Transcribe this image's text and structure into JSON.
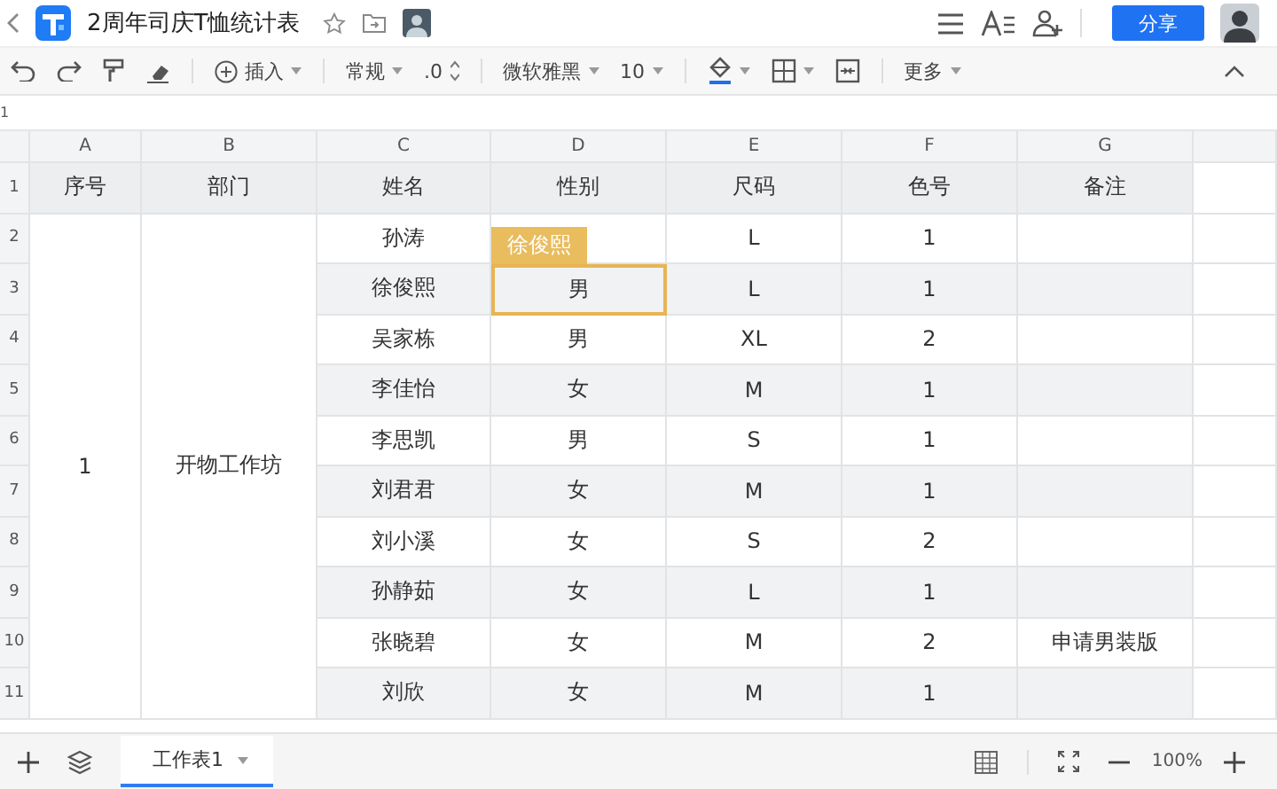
{
  "title": "2周年司庆T恤统计表",
  "share_button": "分享",
  "toolbar": {
    "insert": "插入",
    "number_format": "常规",
    "decimal": ".0",
    "font": "微软雅黑",
    "font_size": "10",
    "more": "更多"
  },
  "formula_bar": {
    "cell_ref": "1"
  },
  "columns": [
    "A",
    "B",
    "C",
    "D",
    "E",
    "F",
    "G"
  ],
  "header_row": {
    "number": "1",
    "cells": [
      "序号",
      "部门",
      "姓名",
      "性别",
      "尺码",
      "色号",
      "备注"
    ]
  },
  "group": {
    "index": "1",
    "department": "开物工作坊"
  },
  "rows": [
    {
      "number": "2",
      "cells": [
        {
          "text": "孙涛",
          "selected": false
        },
        {
          "selected": false
        },
        {
          "text": "L",
          "selected": false
        },
        {
          "text": "1",
          "selected": false
        },
        {
          "selected": false
        }
      ]
    },
    {
      "number": "3",
      "cells": [
        {
          "text": "徐俊熙",
          "selected": false
        },
        {
          "text": "男",
          "selected": true,
          "collaborator": "徐俊熙"
        },
        {
          "text": "L",
          "selected": false
        },
        {
          "text": "1",
          "selected": false
        },
        {
          "selected": false
        }
      ]
    },
    {
      "number": "4",
      "cells": [
        {
          "text": "吴家栋",
          "selected": false
        },
        {
          "text": "男",
          "selected": false
        },
        {
          "text": "XL",
          "selected": false
        },
        {
          "text": "2",
          "selected": false
        },
        {
          "selected": false
        }
      ]
    },
    {
      "number": "5",
      "cells": [
        {
          "text": "李佳怡",
          "selected": false
        },
        {
          "text": "女",
          "selected": false
        },
        {
          "text": "M",
          "selected": false
        },
        {
          "text": "1",
          "selected": false
        },
        {
          "selected": false
        }
      ]
    },
    {
      "number": "6",
      "cells": [
        {
          "text": "李思凯",
          "selected": false
        },
        {
          "text": "男",
          "selected": false
        },
        {
          "text": "S",
          "selected": false
        },
        {
          "text": "1",
          "selected": false
        },
        {
          "selected": false
        }
      ]
    },
    {
      "number": "7",
      "cells": [
        {
          "text": "刘君君",
          "selected": false
        },
        {
          "text": "女",
          "selected": false
        },
        {
          "text": "M",
          "selected": false
        },
        {
          "text": "1",
          "selected": false
        },
        {
          "selected": false
        }
      ]
    },
    {
      "number": "8",
      "cells": [
        {
          "text": "刘小溪",
          "selected": false
        },
        {
          "text": "女",
          "selected": false
        },
        {
          "text": "S",
          "selected": false
        },
        {
          "text": "2",
          "selected": false
        },
        {
          "selected": false
        }
      ]
    },
    {
      "number": "9",
      "cells": [
        {
          "text": "孙静茹",
          "selected": false
        },
        {
          "text": "女",
          "selected": false
        },
        {
          "text": "L",
          "selected": false
        },
        {
          "text": "1",
          "selected": false
        },
        {
          "selected": false
        }
      ]
    },
    {
      "number": "10",
      "cells": [
        {
          "text": "张晓碧",
          "selected": false
        },
        {
          "text": "女",
          "selected": false
        },
        {
          "text": "M",
          "selected": false
        },
        {
          "text": "2",
          "selected": false
        },
        {
          "text": "申请男装版",
          "selected": false
        }
      ]
    },
    {
      "number": "11",
      "cells": [
        {
          "text": "刘欣",
          "selected": false
        },
        {
          "text": "女",
          "selected": false
        },
        {
          "text": "M",
          "selected": false
        },
        {
          "text": "1",
          "selected": false
        },
        {
          "selected": false
        }
      ]
    }
  ],
  "sheet_tabs": [
    {
      "label": "工作表1",
      "selected": true
    }
  ],
  "zoom": "100%"
}
